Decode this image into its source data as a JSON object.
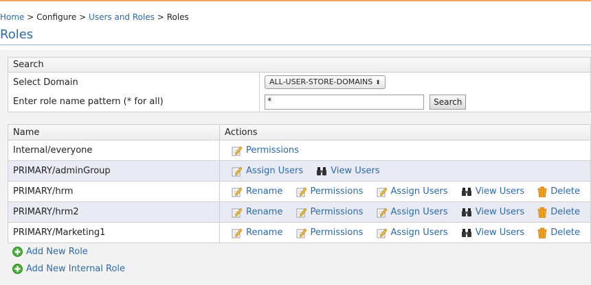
{
  "breadcrumb": {
    "home": "Home",
    "sep1": ">",
    "configure": "Configure",
    "sep2": ">",
    "users_and_roles": "Users and Roles",
    "sep3": ">",
    "current": "Roles"
  },
  "page_title": "Roles",
  "search": {
    "header": "Search",
    "domain_label": "Select Domain",
    "domain_value": "ALL-USER-STORE-DOMAINS",
    "pattern_label": "Enter role name pattern (* for all)",
    "pattern_value": "*",
    "button_label": "Search"
  },
  "roles_table": {
    "col_name": "Name",
    "col_actions": "Actions",
    "rows": [
      {
        "name": "Internal/everyone"
      },
      {
        "name": "PRIMARY/adminGroup"
      },
      {
        "name": "PRIMARY/hrm"
      },
      {
        "name": "PRIMARY/hrm2"
      },
      {
        "name": "PRIMARY/Marketing1"
      }
    ]
  },
  "actions": {
    "rename": "Rename",
    "permissions": "Permissions",
    "assign_users": "Assign Users",
    "view_users": "View Users",
    "delete": "Delete"
  },
  "links": {
    "add_role": "Add New Role",
    "add_internal_role": "Add New Internal Role"
  },
  "colors": {
    "link": "#2c6aa8",
    "accent_line": "#f0a35c",
    "alt_row": "#e8ebf3",
    "add_icon": "#4caf3e"
  }
}
